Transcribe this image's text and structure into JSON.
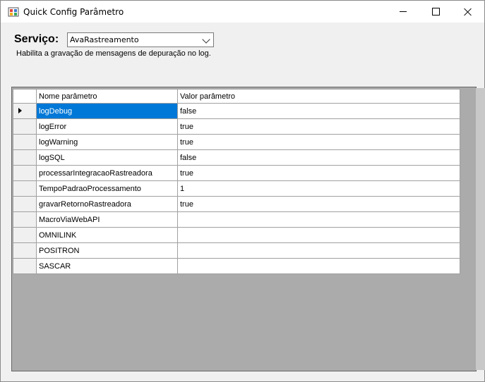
{
  "window": {
    "title": "Quick Config Parâmetro"
  },
  "service": {
    "label": "Serviço:",
    "selected": "AvaRastreamento"
  },
  "description": "Habilita a gravação de mensagens de depuração no log.",
  "grid": {
    "headers": {
      "name": "Nome parâmetro",
      "value": "Valor parâmetro"
    },
    "rows": [
      {
        "name": "logDebug",
        "value": "false"
      },
      {
        "name": "logError",
        "value": "true"
      },
      {
        "name": "logWarning",
        "value": "true"
      },
      {
        "name": "logSQL",
        "value": "false"
      },
      {
        "name": "processarIntegracaoRastreadora",
        "value": "true"
      },
      {
        "name": "TempoPadraoProcessamento",
        "value": "1"
      },
      {
        "name": "gravarRetornoRastreadora",
        "value": "true"
      },
      {
        "name": "MacroViaWebAPI",
        "value": ""
      },
      {
        "name": "OMNILINK",
        "value": ""
      },
      {
        "name": "POSITRON",
        "value": ""
      },
      {
        "name": "SASCAR",
        "value": ""
      }
    ]
  },
  "colors": {
    "selection": "#0078d7",
    "grid_background": "#ababab"
  }
}
